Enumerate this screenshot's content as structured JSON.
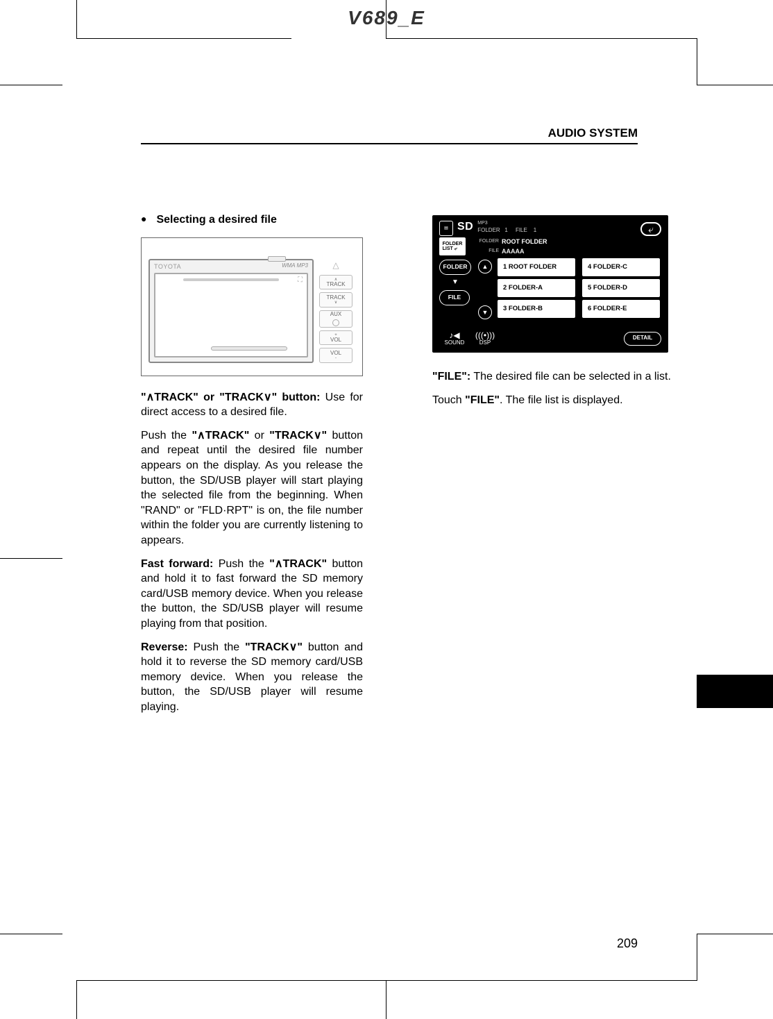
{
  "header": {
    "doc_title": "V689_E",
    "section": "AUDIO SYSTEM"
  },
  "left": {
    "bullet": "●",
    "bullet_title": "Selecting a desired file",
    "headunit": {
      "brand": "TOYOTA",
      "wma": "WMA MP3",
      "track_up_label": "∧\nTRACK",
      "track_dn_label": "TRACK\n∨",
      "vol_up": "+\nVOL",
      "vol_dn": "VOL\n-",
      "aux": "AUX",
      "tri": "△"
    },
    "p1_b": "\"∧TRACK\" or \"TRACK∨\" button:",
    "p1_rest": " Use for direct access to a desired file.",
    "p2_pre": "Push the ",
    "p2_b1": "\"∧TRACK\"",
    "p2_mid": " or ",
    "p2_b2": "\"TRACK∨\"",
    "p2_post": " button and repeat until the desired file number appears on the display.  As you release the button, the SD/USB player will start playing the selected file from the beginning.  When \"RAND\" or \"FLD·RPT\" is on, the file number within the folder you are currently listening to appears.",
    "p3_b": "Fast forward:",
    "p3_mid": " Push the ",
    "p3_b2": "\"∧TRACK\"",
    "p3_post": " button and hold it to fast forward the SD memory card/USB memory device.  When you release the button, the SD/USB player will resume playing from that position.",
    "p4_b": "Reverse:",
    "p4_mid": " Push the ",
    "p4_b2": "\"TRACK∨\"",
    "p4_post": " button and hold it to reverse the SD memory card/USB memory device.  When you release the button, the SD/USB player will resume playing."
  },
  "right": {
    "touchscreen": {
      "sd": "SD",
      "mp3": "MP3",
      "count_folder_label": "FOLDER",
      "count_folder_value": "1",
      "count_file_label": "FILE",
      "count_file_value": "1",
      "back": "⤶",
      "folderlist": "FOLDER\nLIST",
      "folderlist_icon": "⤶",
      "folder_label": "FOLDER",
      "folder_value": "ROOT FOLDER",
      "file_label": "FILE",
      "file_value": "AAAAA",
      "btn_folder": "FOLDER",
      "btn_file": "FILE",
      "up": "▲",
      "dn": "▼",
      "items": [
        "1 ROOT FOLDER",
        "2 FOLDER-A",
        "3 FOLDER-B",
        "4 FOLDER-C",
        "5 FOLDER-D",
        "6 FOLDER-E"
      ],
      "detail": "DETAIL",
      "sound_icon": "🔉",
      "sound": "SOUND",
      "dsp_icon": "(((•)))",
      "dsp": "DSP"
    },
    "p1_b": "\"FILE\":",
    "p1_rest": " The desired file can be selected in a list.",
    "p2_pre": "Touch ",
    "p2_b": "\"FILE\"",
    "p2_post": ". The file list is displayed."
  },
  "page": "209"
}
